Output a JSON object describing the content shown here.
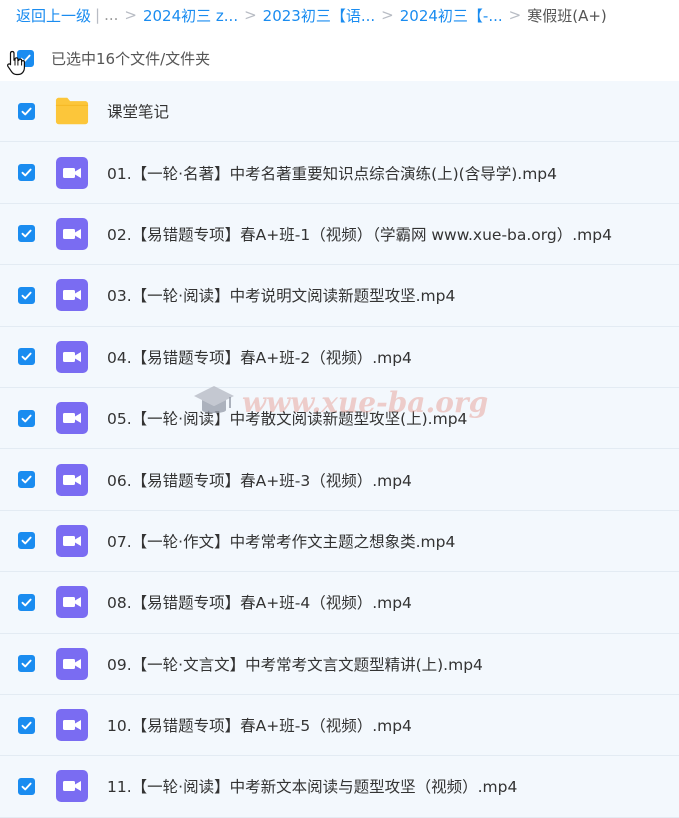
{
  "breadcrumb": {
    "back": "返回上一级",
    "ellipsis": "...",
    "crumbs": [
      "2024初三 z...",
      "2023初三【语...",
      "2024初三【-..."
    ],
    "current": "寒假班(A+)"
  },
  "selection": {
    "text": "已选中16个文件/文件夹"
  },
  "files": [
    {
      "name": "课堂笔记",
      "type": "folder"
    },
    {
      "name": "01.【一轮·名著】中考名著重要知识点综合演练(上)(含导学).mp4",
      "type": "video"
    },
    {
      "name": "02.【易错题专项】春A+班-1（视频）（学霸网 www.xue-ba.org）.mp4",
      "type": "video"
    },
    {
      "name": "03.【一轮·阅读】中考说明文阅读新题型攻坚.mp4",
      "type": "video"
    },
    {
      "name": "04.【易错题专项】春A+班-2（视频）.mp4",
      "type": "video"
    },
    {
      "name": "05.【一轮·阅读】中考散文阅读新题型攻坚(上).mp4",
      "type": "video"
    },
    {
      "name": "06.【易错题专项】春A+班-3（视频）.mp4",
      "type": "video"
    },
    {
      "name": "07.【一轮·作文】中考常考作文主题之想象类.mp4",
      "type": "video"
    },
    {
      "name": "08.【易错题专项】春A+班-4（视频）.mp4",
      "type": "video"
    },
    {
      "name": "09.【一轮·文言文】中考常考文言文题型精讲(上).mp4",
      "type": "video"
    },
    {
      "name": "10.【易错题专项】春A+班-5（视频）.mp4",
      "type": "video"
    },
    {
      "name": "11.【一轮·阅读】中考新文本阅读与题型攻坚（视频）.mp4",
      "type": "video"
    }
  ],
  "watermark": {
    "text": "www.xue-ba.org"
  },
  "colors": {
    "accent": "#1a8cf0",
    "row_bg": "#f3f8fd",
    "folder": "#fcc63a",
    "video": "#7a6cf2"
  }
}
